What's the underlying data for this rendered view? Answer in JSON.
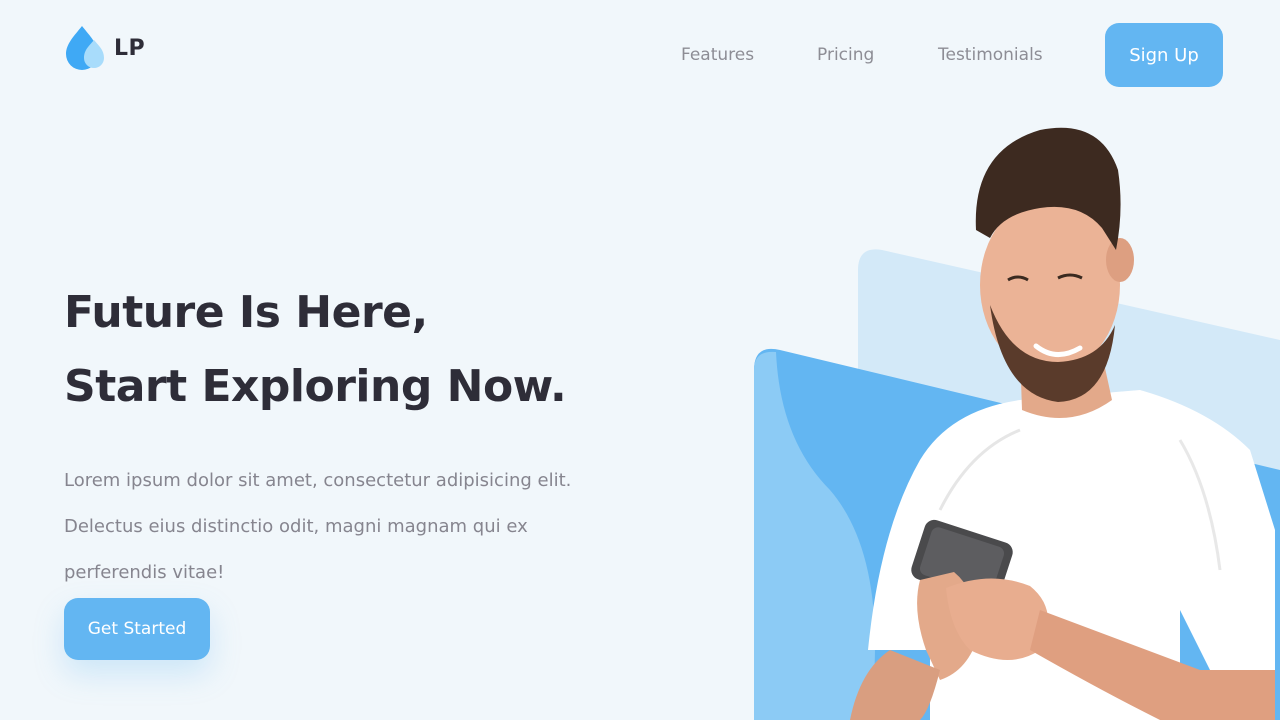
{
  "brand": {
    "logo_icon": "droplet-icon",
    "name": "LP",
    "accent_color": "#63b6f2",
    "light_accent_color": "#8fd0f7"
  },
  "nav": {
    "items": [
      {
        "label": "Features"
      },
      {
        "label": "Pricing"
      },
      {
        "label": "Testimonials"
      }
    ],
    "signup_label": "Sign Up"
  },
  "hero": {
    "title_line1": "Future Is Here,",
    "title_line2": "Start Exploring Now.",
    "description": "Lorem ipsum dolor sit amet, consectetur adipisicing elit. Delectus eius distinctio odit, magni magnam qui ex perferendis vitae!",
    "cta_label": "Get Started"
  },
  "illustration": {
    "subject": "man-with-phone-photo"
  }
}
